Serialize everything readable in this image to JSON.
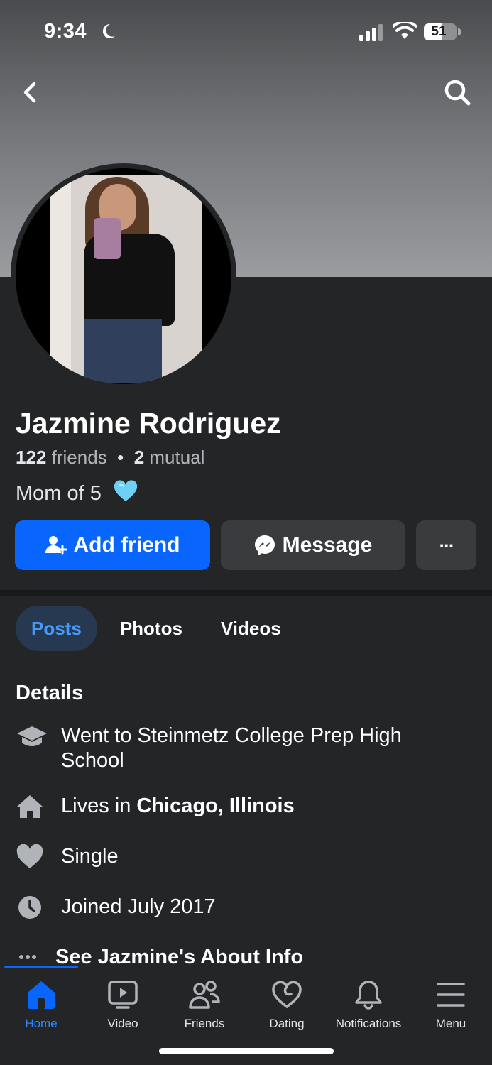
{
  "status_bar": {
    "time": "9:34",
    "battery": "51"
  },
  "profile": {
    "name": "Jazmine Rodriguez",
    "friends_count": "122",
    "friends_label": "friends",
    "separator": "•",
    "mutual_count": "2",
    "mutual_label": "mutual",
    "bio": "Mom of 5",
    "bio_emoji": "light-blue-heart"
  },
  "actions": {
    "add_friend": "Add friend",
    "message": "Message",
    "more": "···"
  },
  "tabs": [
    {
      "label": "Posts",
      "active": true
    },
    {
      "label": "Photos",
      "active": false
    },
    {
      "label": "Videos",
      "active": false
    }
  ],
  "details": {
    "title": "Details",
    "items": [
      {
        "icon": "graduation-cap-icon",
        "text": "Went to Steinmetz College Prep High School"
      },
      {
        "icon": "house-icon",
        "prefix": "Lives in ",
        "bold": "Chicago, Illinois"
      },
      {
        "icon": "heart-icon",
        "text": "Single"
      },
      {
        "icon": "clock-icon",
        "text": "Joined July 2017"
      }
    ],
    "see_about": "See Jazmine's About Info"
  },
  "bottom_nav": [
    {
      "label": "Home",
      "icon": "home-icon",
      "active": true
    },
    {
      "label": "Video",
      "icon": "video-icon",
      "active": false
    },
    {
      "label": "Friends",
      "icon": "friends-icon",
      "active": false
    },
    {
      "label": "Dating",
      "icon": "dating-icon",
      "active": false
    },
    {
      "label": "Notifications",
      "icon": "bell-icon",
      "active": false
    },
    {
      "label": "Menu",
      "icon": "menu-icon",
      "active": false
    }
  ],
  "colors": {
    "background": "#242527",
    "primary": "#0866ff",
    "active_tab_bg": "#263951",
    "active_tab_text": "#4599ff",
    "secondary_button": "#3a3b3c"
  }
}
